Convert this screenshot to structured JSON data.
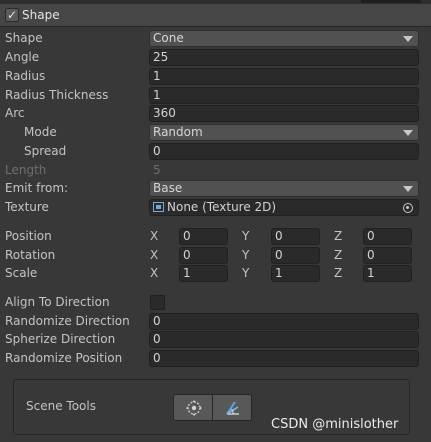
{
  "header": {
    "enabled": true,
    "check_glyph": "✓",
    "title": "Shape"
  },
  "shape": {
    "label": "Shape",
    "value": "Cone"
  },
  "angle": {
    "label": "Angle",
    "value": "25"
  },
  "radius": {
    "label": "Radius",
    "value": "1"
  },
  "radius_thickness": {
    "label": "Radius Thickness",
    "value": "1"
  },
  "arc": {
    "label": "Arc",
    "value": "360",
    "mode": {
      "label": "Mode",
      "value": "Random"
    },
    "spread": {
      "label": "Spread",
      "value": "0"
    }
  },
  "length": {
    "label": "Length",
    "value": "5",
    "disabled": true
  },
  "emit_from": {
    "label": "Emit from:",
    "value": "Base"
  },
  "texture": {
    "label": "Texture",
    "value": "None (Texture 2D)",
    "icon": "texture-icon"
  },
  "transform": {
    "position": {
      "label": "Position",
      "x": "0",
      "y": "0",
      "z": "0"
    },
    "rotation": {
      "label": "Rotation",
      "x": "0",
      "y": "0",
      "z": "0"
    },
    "scale": {
      "label": "Scale",
      "x": "1",
      "y": "1",
      "z": "1"
    },
    "axis_labels": {
      "x": "X",
      "y": "Y",
      "z": "Z"
    }
  },
  "align_to_direction": {
    "label": "Align To Direction",
    "checked": false
  },
  "randomize_direction": {
    "label": "Randomize Direction",
    "value": "0"
  },
  "spherize_direction": {
    "label": "Spherize Direction",
    "value": "0"
  },
  "randomize_position": {
    "label": "Randomize Position",
    "value": "0"
  },
  "scene_tools": {
    "label": "Scene Tools",
    "buttons": [
      "transform-gizmo-icon",
      "shape-edit-icon"
    ]
  },
  "watermark": "CSDN @minislother",
  "colors": {
    "background": "#383838",
    "field": "#2a2a2a",
    "dropdown": "#515151",
    "header": "#464646",
    "text": "#c4c4c4",
    "disabled_text": "#6e6e6e",
    "icon_blue": "#7ca7d3"
  }
}
